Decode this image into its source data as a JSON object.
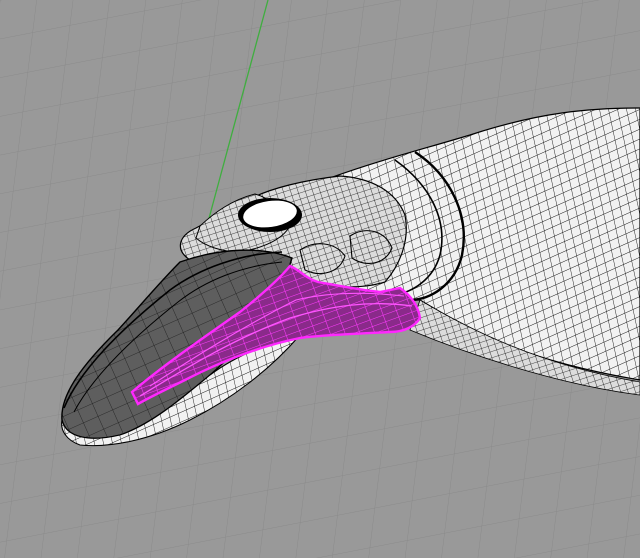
{
  "viewport": {
    "type": "perspective-3d-wireframe",
    "background_color": "#999999",
    "grid_color": "#8c8c8c",
    "y_axis_color": "#3fae3f",
    "wireframe_color": "#000000",
    "surface_color": "#ffffff",
    "selection_color": "#e61ee6",
    "selected_object": "jaw-surface",
    "model": "fish-head-nurbs-model"
  }
}
